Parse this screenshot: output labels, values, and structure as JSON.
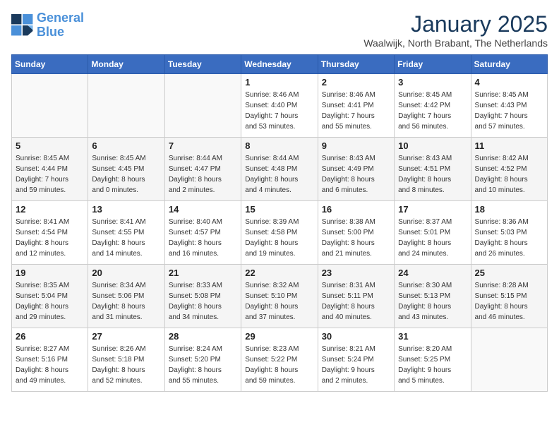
{
  "header": {
    "logo_line1": "General",
    "logo_line2": "Blue",
    "month": "January 2025",
    "location": "Waalwijk, North Brabant, The Netherlands"
  },
  "weekdays": [
    "Sunday",
    "Monday",
    "Tuesday",
    "Wednesday",
    "Thursday",
    "Friday",
    "Saturday"
  ],
  "weeks": [
    [
      {
        "day": "",
        "info": ""
      },
      {
        "day": "",
        "info": ""
      },
      {
        "day": "",
        "info": ""
      },
      {
        "day": "1",
        "info": "Sunrise: 8:46 AM\nSunset: 4:40 PM\nDaylight: 7 hours\nand 53 minutes."
      },
      {
        "day": "2",
        "info": "Sunrise: 8:46 AM\nSunset: 4:41 PM\nDaylight: 7 hours\nand 55 minutes."
      },
      {
        "day": "3",
        "info": "Sunrise: 8:45 AM\nSunset: 4:42 PM\nDaylight: 7 hours\nand 56 minutes."
      },
      {
        "day": "4",
        "info": "Sunrise: 8:45 AM\nSunset: 4:43 PM\nDaylight: 7 hours\nand 57 minutes."
      }
    ],
    [
      {
        "day": "5",
        "info": "Sunrise: 8:45 AM\nSunset: 4:44 PM\nDaylight: 7 hours\nand 59 minutes."
      },
      {
        "day": "6",
        "info": "Sunrise: 8:45 AM\nSunset: 4:45 PM\nDaylight: 8 hours\nand 0 minutes."
      },
      {
        "day": "7",
        "info": "Sunrise: 8:44 AM\nSunset: 4:47 PM\nDaylight: 8 hours\nand 2 minutes."
      },
      {
        "day": "8",
        "info": "Sunrise: 8:44 AM\nSunset: 4:48 PM\nDaylight: 8 hours\nand 4 minutes."
      },
      {
        "day": "9",
        "info": "Sunrise: 8:43 AM\nSunset: 4:49 PM\nDaylight: 8 hours\nand 6 minutes."
      },
      {
        "day": "10",
        "info": "Sunrise: 8:43 AM\nSunset: 4:51 PM\nDaylight: 8 hours\nand 8 minutes."
      },
      {
        "day": "11",
        "info": "Sunrise: 8:42 AM\nSunset: 4:52 PM\nDaylight: 8 hours\nand 10 minutes."
      }
    ],
    [
      {
        "day": "12",
        "info": "Sunrise: 8:41 AM\nSunset: 4:54 PM\nDaylight: 8 hours\nand 12 minutes."
      },
      {
        "day": "13",
        "info": "Sunrise: 8:41 AM\nSunset: 4:55 PM\nDaylight: 8 hours\nand 14 minutes."
      },
      {
        "day": "14",
        "info": "Sunrise: 8:40 AM\nSunset: 4:57 PM\nDaylight: 8 hours\nand 16 minutes."
      },
      {
        "day": "15",
        "info": "Sunrise: 8:39 AM\nSunset: 4:58 PM\nDaylight: 8 hours\nand 19 minutes."
      },
      {
        "day": "16",
        "info": "Sunrise: 8:38 AM\nSunset: 5:00 PM\nDaylight: 8 hours\nand 21 minutes."
      },
      {
        "day": "17",
        "info": "Sunrise: 8:37 AM\nSunset: 5:01 PM\nDaylight: 8 hours\nand 24 minutes."
      },
      {
        "day": "18",
        "info": "Sunrise: 8:36 AM\nSunset: 5:03 PM\nDaylight: 8 hours\nand 26 minutes."
      }
    ],
    [
      {
        "day": "19",
        "info": "Sunrise: 8:35 AM\nSunset: 5:04 PM\nDaylight: 8 hours\nand 29 minutes."
      },
      {
        "day": "20",
        "info": "Sunrise: 8:34 AM\nSunset: 5:06 PM\nDaylight: 8 hours\nand 31 minutes."
      },
      {
        "day": "21",
        "info": "Sunrise: 8:33 AM\nSunset: 5:08 PM\nDaylight: 8 hours\nand 34 minutes."
      },
      {
        "day": "22",
        "info": "Sunrise: 8:32 AM\nSunset: 5:10 PM\nDaylight: 8 hours\nand 37 minutes."
      },
      {
        "day": "23",
        "info": "Sunrise: 8:31 AM\nSunset: 5:11 PM\nDaylight: 8 hours\nand 40 minutes."
      },
      {
        "day": "24",
        "info": "Sunrise: 8:30 AM\nSunset: 5:13 PM\nDaylight: 8 hours\nand 43 minutes."
      },
      {
        "day": "25",
        "info": "Sunrise: 8:28 AM\nSunset: 5:15 PM\nDaylight: 8 hours\nand 46 minutes."
      }
    ],
    [
      {
        "day": "26",
        "info": "Sunrise: 8:27 AM\nSunset: 5:16 PM\nDaylight: 8 hours\nand 49 minutes."
      },
      {
        "day": "27",
        "info": "Sunrise: 8:26 AM\nSunset: 5:18 PM\nDaylight: 8 hours\nand 52 minutes."
      },
      {
        "day": "28",
        "info": "Sunrise: 8:24 AM\nSunset: 5:20 PM\nDaylight: 8 hours\nand 55 minutes."
      },
      {
        "day": "29",
        "info": "Sunrise: 8:23 AM\nSunset: 5:22 PM\nDaylight: 8 hours\nand 59 minutes."
      },
      {
        "day": "30",
        "info": "Sunrise: 8:21 AM\nSunset: 5:24 PM\nDaylight: 9 hours\nand 2 minutes."
      },
      {
        "day": "31",
        "info": "Sunrise: 8:20 AM\nSunset: 5:25 PM\nDaylight: 9 hours\nand 5 minutes."
      },
      {
        "day": "",
        "info": ""
      }
    ]
  ]
}
